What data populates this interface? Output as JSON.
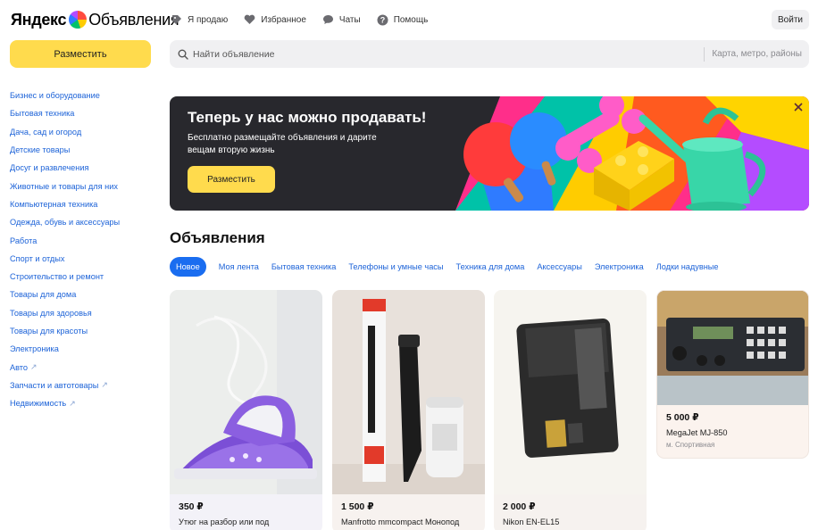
{
  "header": {
    "logo_brand": "Яндекс",
    "logo_product": "Объявления",
    "nav": [
      {
        "label": "Я продаю",
        "icon": "tag-icon"
      },
      {
        "label": "Избранное",
        "icon": "heart-icon"
      },
      {
        "label": "Чаты",
        "icon": "chat-icon"
      },
      {
        "label": "Помощь",
        "icon": "help-icon"
      }
    ],
    "login_label": "Войти"
  },
  "sidebar": {
    "place_label": "Разместить",
    "categories": [
      {
        "label": "Бизнес и оборудование"
      },
      {
        "label": "Бытовая техника"
      },
      {
        "label": "Дача, сад и огород"
      },
      {
        "label": "Детские товары"
      },
      {
        "label": "Досуг и развлечения"
      },
      {
        "label": "Животные и товары для них"
      },
      {
        "label": "Компьютерная техника"
      },
      {
        "label": "Одежда, обувь и аксессуары"
      },
      {
        "label": "Работа"
      },
      {
        "label": "Спорт и отдых"
      },
      {
        "label": "Строительство и ремонт"
      },
      {
        "label": "Товары для дома"
      },
      {
        "label": "Товары для здоровья"
      },
      {
        "label": "Товары для красоты"
      },
      {
        "label": "Электроника"
      },
      {
        "label": "Авто",
        "external": true
      },
      {
        "label": "Запчасти и автотовары",
        "external": true
      },
      {
        "label": "Недвижимость",
        "external": true
      }
    ]
  },
  "search": {
    "placeholder": "Найти объявление",
    "region_placeholder": "Карта, метро, районы"
  },
  "banner": {
    "title": "Теперь у нас можно продавать!",
    "subtitle": "Бесплатно размещайте объявления и дарите вещам вторую жизнь",
    "button_label": "Разместить"
  },
  "listings": {
    "title": "Объявления",
    "tabs": [
      {
        "label": "Новое",
        "active": true
      },
      {
        "label": "Моя лента"
      },
      {
        "label": "Бытовая техника"
      },
      {
        "label": "Телефоны и умные часы"
      },
      {
        "label": "Техника для дома"
      },
      {
        "label": "Аксессуары"
      },
      {
        "label": "Электроника"
      },
      {
        "label": "Лодки надувные"
      }
    ],
    "cards": [
      {
        "price": "350 ₽",
        "title": "Утюг на разбор или под",
        "location": ""
      },
      {
        "price": "1 500 ₽",
        "title": "Manfrotto mmcompact Монопод",
        "location": ""
      },
      {
        "price": "2 000 ₽",
        "title": "Nikon EN-EL15",
        "location": ""
      },
      {
        "price": "5 000 ₽",
        "title": "MegaJet MJ-850",
        "location": "м. Спортивная"
      }
    ]
  },
  "colors": {
    "accent_yellow": "#ffdb4d",
    "link_blue": "#1d63d8",
    "tab_active": "#1a6df0",
    "banner_bg": "#28282d"
  }
}
